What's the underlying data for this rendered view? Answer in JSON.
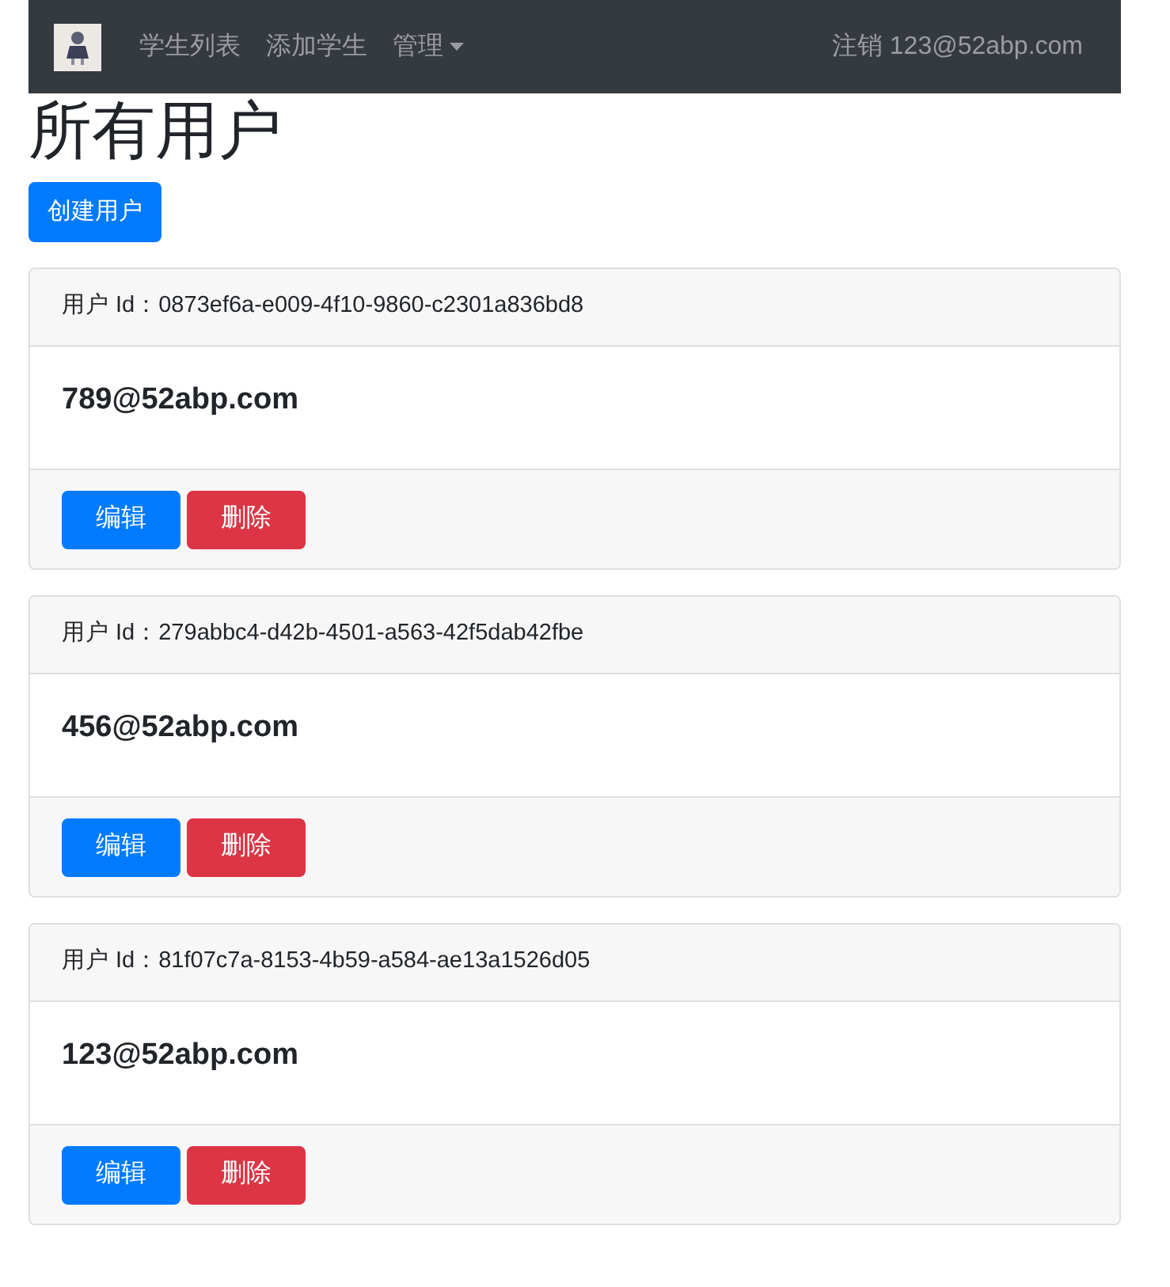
{
  "navbar": {
    "links": [
      {
        "label": "学生列表",
        "kind": "link"
      },
      {
        "label": "添加学生",
        "kind": "link"
      },
      {
        "label": "管理",
        "kind": "dropdown"
      }
    ],
    "account_link": "注销 123@52abp.com"
  },
  "heading": "所有用户",
  "create_button": "创建用户",
  "users": [
    {
      "id_line": "用户 Id：0873ef6a-e009-4f10-9860-c2301a836bd8",
      "email": "789@52abp.com",
      "buttons": [
        {
          "label": "编辑",
          "kind": "primary"
        },
        {
          "label": "删除",
          "kind": "danger"
        }
      ]
    },
    {
      "id_line": "用户 Id：279abbc4-d42b-4501-a563-42f5dab42fbe",
      "email": "456@52abp.com",
      "buttons": [
        {
          "label": "编辑",
          "kind": "primary"
        },
        {
          "label": "删除",
          "kind": "danger"
        }
      ]
    },
    {
      "id_line": "用户 Id：81f07c7a-8153-4b59-a584-ae13a1526d05",
      "email": "123@52abp.com",
      "buttons": [
        {
          "label": "编辑",
          "kind": "primary"
        },
        {
          "label": "删除",
          "kind": "danger"
        }
      ]
    }
  ]
}
